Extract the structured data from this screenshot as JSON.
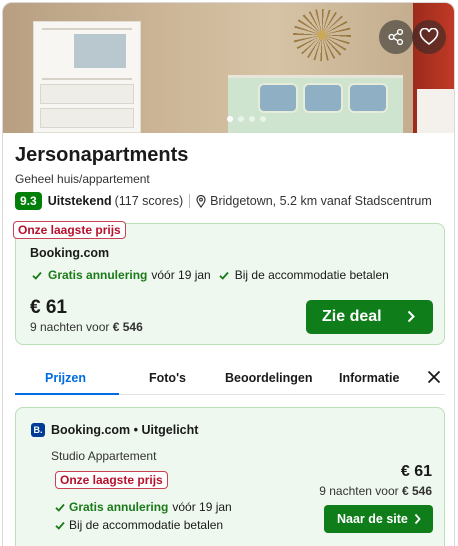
{
  "hotel": {
    "name": "Jersonapartments",
    "type": "Geheel huis/appartement",
    "score": "9.3",
    "rating_word": "Uitstekend",
    "rating_count": "(117 scores)",
    "location": "Bridgetown, 5.2 km vanaf Stadscentrum"
  },
  "photo": {
    "dots_total": 4,
    "dots_active": 1
  },
  "top_deal": {
    "badge": "Onze laagste prijs",
    "provider": "Booking.com",
    "feature1_bold": "Gratis annulering",
    "feature1_rest": "vóór 19 jan",
    "feature2": "Bij de accommodatie betalen",
    "price": "€ 61",
    "sub_prefix": "9 nachten voor",
    "sub_total": "€ 546",
    "button": "Zie deal"
  },
  "tabs": [
    {
      "label": "Prijzen",
      "active": true
    },
    {
      "label": "Foto's",
      "active": false
    },
    {
      "label": "Beoordelingen",
      "active": false
    },
    {
      "label": "Informatie",
      "active": false
    }
  ],
  "offer": {
    "logo_letter": "B.",
    "provider": "Booking.com • Uitgelicht",
    "room": "Studio Appartement",
    "badge": "Onze laagste prijs",
    "feature1_bold": "Gratis annulering",
    "feature1_rest": "vóór 19 jan",
    "feature2": "Bij de accommodatie betalen",
    "price": "€ 61",
    "sub_prefix": "9 nachten voor",
    "sub_total": "€ 546",
    "button": "Naar de site"
  },
  "colors": {
    "score_bg": "#008009",
    "deal_bg": "#eef8ee",
    "cta_green": "#0f7d1a",
    "badge_red": "#b7102c",
    "tab_active": "#006ce4"
  }
}
